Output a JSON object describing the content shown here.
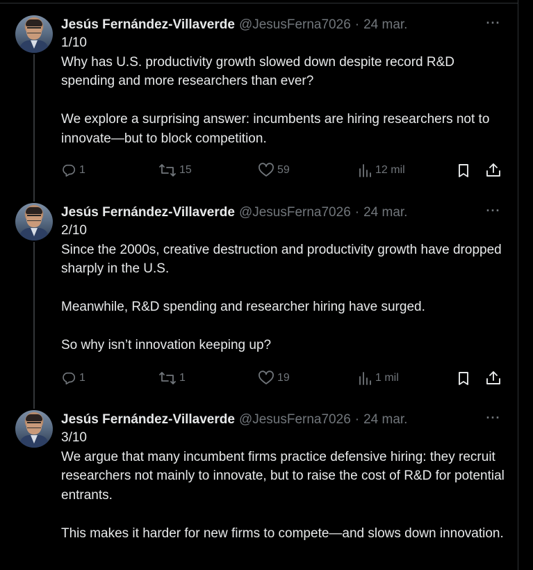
{
  "author": {
    "name": "Jesús Fernández-Villaverde",
    "handle": "@JesusFerna7026",
    "separator": "·"
  },
  "tweets": [
    {
      "date": "24 mar.",
      "index": "1/10",
      "paragraphs": [
        "Why has U.S. productivity growth slowed down despite record R&D spending and more researchers than ever?",
        "We explore a surprising answer: incumbents are hiring researchers not to innovate—but to block competition."
      ],
      "replies": "1",
      "reposts": "15",
      "likes": "59",
      "views": "12 mil"
    },
    {
      "date": "24 mar.",
      "index": "2/10",
      "paragraphs": [
        "Since the 2000s, creative destruction and productivity growth have dropped sharply in the U.S.",
        "Meanwhile, R&D spending and researcher hiring have surged.",
        "So why isn’t innovation keeping up?"
      ],
      "replies": "1",
      "reposts": "1",
      "likes": "19",
      "views": "1 mil"
    },
    {
      "date": "24 mar.",
      "index": "3/10",
      "paragraphs": [
        "We argue that many incumbent firms practice defensive hiring: they recruit researchers not mainly to innovate, but to raise the cost of R&D for potential entrants.",
        "This makes it harder for new firms to compete—and slows down innovation."
      ]
    }
  ],
  "icons": {
    "reply": "reply-icon",
    "repost": "repost-icon",
    "like": "heart-icon",
    "views": "views-icon",
    "bookmark": "bookmark-icon",
    "share": "share-icon",
    "more": "more-icon"
  },
  "colors": {
    "background": "#000000",
    "text": "#e7e9ea",
    "muted": "#71767b",
    "divider": "#2f3336"
  }
}
